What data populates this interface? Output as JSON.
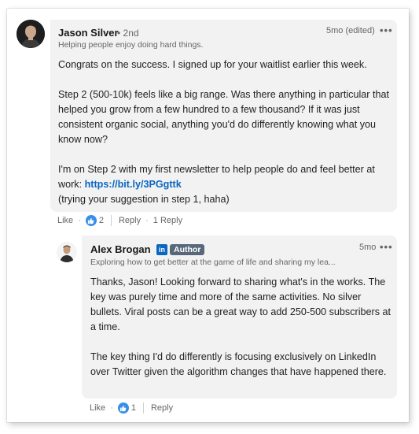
{
  "comment": {
    "author_name": "Jason Silver",
    "degree": "• 2nd",
    "headline": "Helping people enjoy doing hard things.",
    "time": "5mo (edited)",
    "more_icon": "•••",
    "body": {
      "p1": "Congrats on the success. I signed up for your waitlist earlier this week.",
      "p2": "Step 2 (500-10k) feels like a big range. Was there anything in particular that helped you grow from a few hundred to a few thousand? If it was just consistent organic social, anything you'd do differently knowing what you know now?",
      "p3_text": "I'm on Step 2 with my first newsletter to help people do and feel better at work: ",
      "p3_link": "https://bit.ly/3PGgttk",
      "p4": "(trying your suggestion in step 1, haha)"
    },
    "actions": {
      "like_label": "Like",
      "like_count": "2",
      "reply_label": "Reply",
      "replies_count": "1 Reply"
    }
  },
  "reply": {
    "author_name": "Alex Brogan",
    "linkedin_badge": "in",
    "author_badge": "Author",
    "headline": "Exploring how to get better at the game of life and sharing my lea...",
    "time": "5mo",
    "more_icon": "•••",
    "body": {
      "p1": "Thanks, Jason! Looking forward to sharing what's in the works. The key was purely time and more of the same activities. No silver bullets. Viral posts can be a great way to add 250-500 subscribers at a time.",
      "p2": "The key thing I'd do differently is focusing exclusively on LinkedIn over Twitter given the algorithm changes that have happened there."
    },
    "actions": {
      "like_label": "Like",
      "like_count": "1",
      "reply_label": "Reply"
    }
  },
  "colors": {
    "link": "#0a66c2",
    "like_badge": "#378fe9",
    "bubble": "#f2f2f2"
  }
}
